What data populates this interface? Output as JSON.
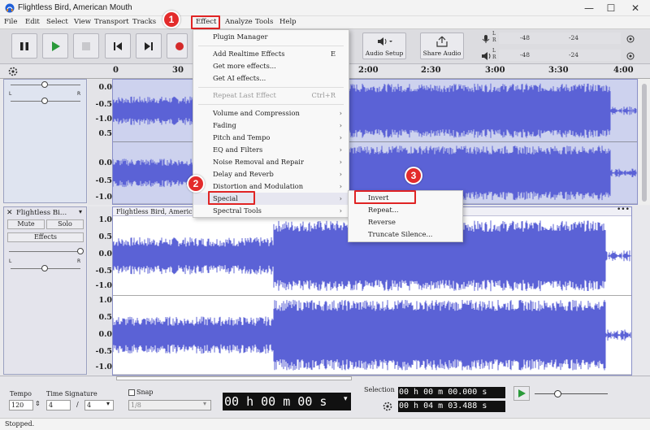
{
  "window": {
    "title": "Flightless Bird, American Mouth",
    "min": "—",
    "max": "☐",
    "close": "✕"
  },
  "menubar": [
    "File",
    "Edit",
    "Select",
    "View",
    "Transport",
    "Tracks",
    "Effect",
    "Analyze",
    "Tools",
    "Help"
  ],
  "toolbar": {
    "audio_setup": "Audio Setup",
    "share_audio": "Share Audio",
    "meter_ticks": [
      "-48",
      "-24"
    ],
    "meter_lr": [
      "L",
      "R"
    ]
  },
  "ruler": {
    "ticks": [
      "0",
      "30",
      "2:00",
      "2:30",
      "3:00",
      "3:30",
      "4:00"
    ]
  },
  "scales": [
    "0.0",
    "-0.5",
    "-1.0",
    "0.5",
    "0.0",
    "-0.5",
    "-1.0",
    "1.0",
    "0.5",
    "0.0",
    "-0.5",
    "-1.0",
    "1.0",
    "0.5",
    "0.0",
    "-0.5",
    "-1.0"
  ],
  "track1": {
    "pan_l": "L",
    "pan_r": "R"
  },
  "track2": {
    "name": "Flightless Bi…",
    "clip_name": "Flightless Bird, Americ",
    "mute": "Mute",
    "solo": "Solo",
    "effects": "Effects",
    "pan_l": "L",
    "pan_r": "R"
  },
  "effect_menu": {
    "items": [
      {
        "label": "Plugin Manager",
        "arrow": "",
        "shortcut": ""
      },
      {
        "label": "Add Realtime Effects",
        "arrow": "",
        "shortcut": "E"
      },
      {
        "label": "Get more effects...",
        "arrow": "",
        "shortcut": ""
      },
      {
        "label": "Get AI effects...",
        "arrow": "",
        "shortcut": ""
      },
      {
        "label": "Repeat Last Effect",
        "arrow": "",
        "shortcut": "Ctrl+R"
      },
      {
        "label": "Volume and Compression",
        "arrow": "›",
        "shortcut": ""
      },
      {
        "label": "Fading",
        "arrow": "›",
        "shortcut": ""
      },
      {
        "label": "Pitch and Tempo",
        "arrow": "›",
        "shortcut": ""
      },
      {
        "label": "EQ and Filters",
        "arrow": "›",
        "shortcut": ""
      },
      {
        "label": "Noise Removal and Repair",
        "arrow": "›",
        "shortcut": ""
      },
      {
        "label": "Delay and Reverb",
        "arrow": "›",
        "shortcut": ""
      },
      {
        "label": "Distortion and Modulation",
        "arrow": "›",
        "shortcut": ""
      },
      {
        "label": "Special",
        "arrow": "›",
        "shortcut": ""
      },
      {
        "label": "Spectral Tools",
        "arrow": "›",
        "shortcut": ""
      }
    ]
  },
  "special_menu": {
    "items": [
      "Invert",
      "Repeat...",
      "Reverse",
      "Truncate Silence..."
    ]
  },
  "badges": [
    "1",
    "2",
    "3"
  ],
  "bottom": {
    "tempo_label": "Tempo",
    "tempo_value": "120",
    "timesig_label": "Time Signature",
    "timesig_num": "4",
    "timesig_sep": "/",
    "timesig_den": "4",
    "snap_label": "Snap",
    "snap_value": "1/8",
    "time_display": "00 h 00 m 00 s",
    "selection_label": "Selection",
    "sel_start": "00 h 00 m 00.000 s",
    "sel_end": "00 h 04 m 03.488 s"
  },
  "status": "Stopped.",
  "colors": {
    "wave": "#5b62d6",
    "selection": "#ffffff",
    "unselected": "#cdd2ee",
    "accent_red": "#e02424"
  }
}
